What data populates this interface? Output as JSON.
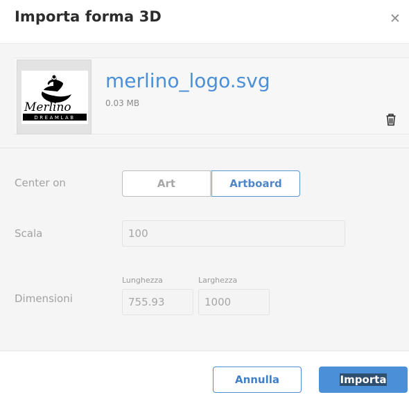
{
  "dialog": {
    "title": "Importa forma 3D",
    "close_icon": "close-icon"
  },
  "file": {
    "name": "merlino_logo.svg",
    "size": "0.03 MB",
    "thumbnail_icon": "merlino-logo-thumbnail",
    "delete_icon": "trash-icon"
  },
  "form": {
    "center_on": {
      "label": "Center on",
      "options": [
        "Art",
        "Artboard"
      ],
      "selected": "Artboard"
    },
    "scale": {
      "label": "Scala",
      "value": "100"
    },
    "dimensions": {
      "label": "Dimensioni",
      "length_label": "Lunghezza",
      "length_value": "755.93",
      "width_label": "Larghezza",
      "width_value": "1000"
    }
  },
  "footer": {
    "cancel_label": "Annulla",
    "import_label": "Importa"
  },
  "colors": {
    "accent": "#4a8fd8",
    "file_name": "#4a8fd8"
  }
}
